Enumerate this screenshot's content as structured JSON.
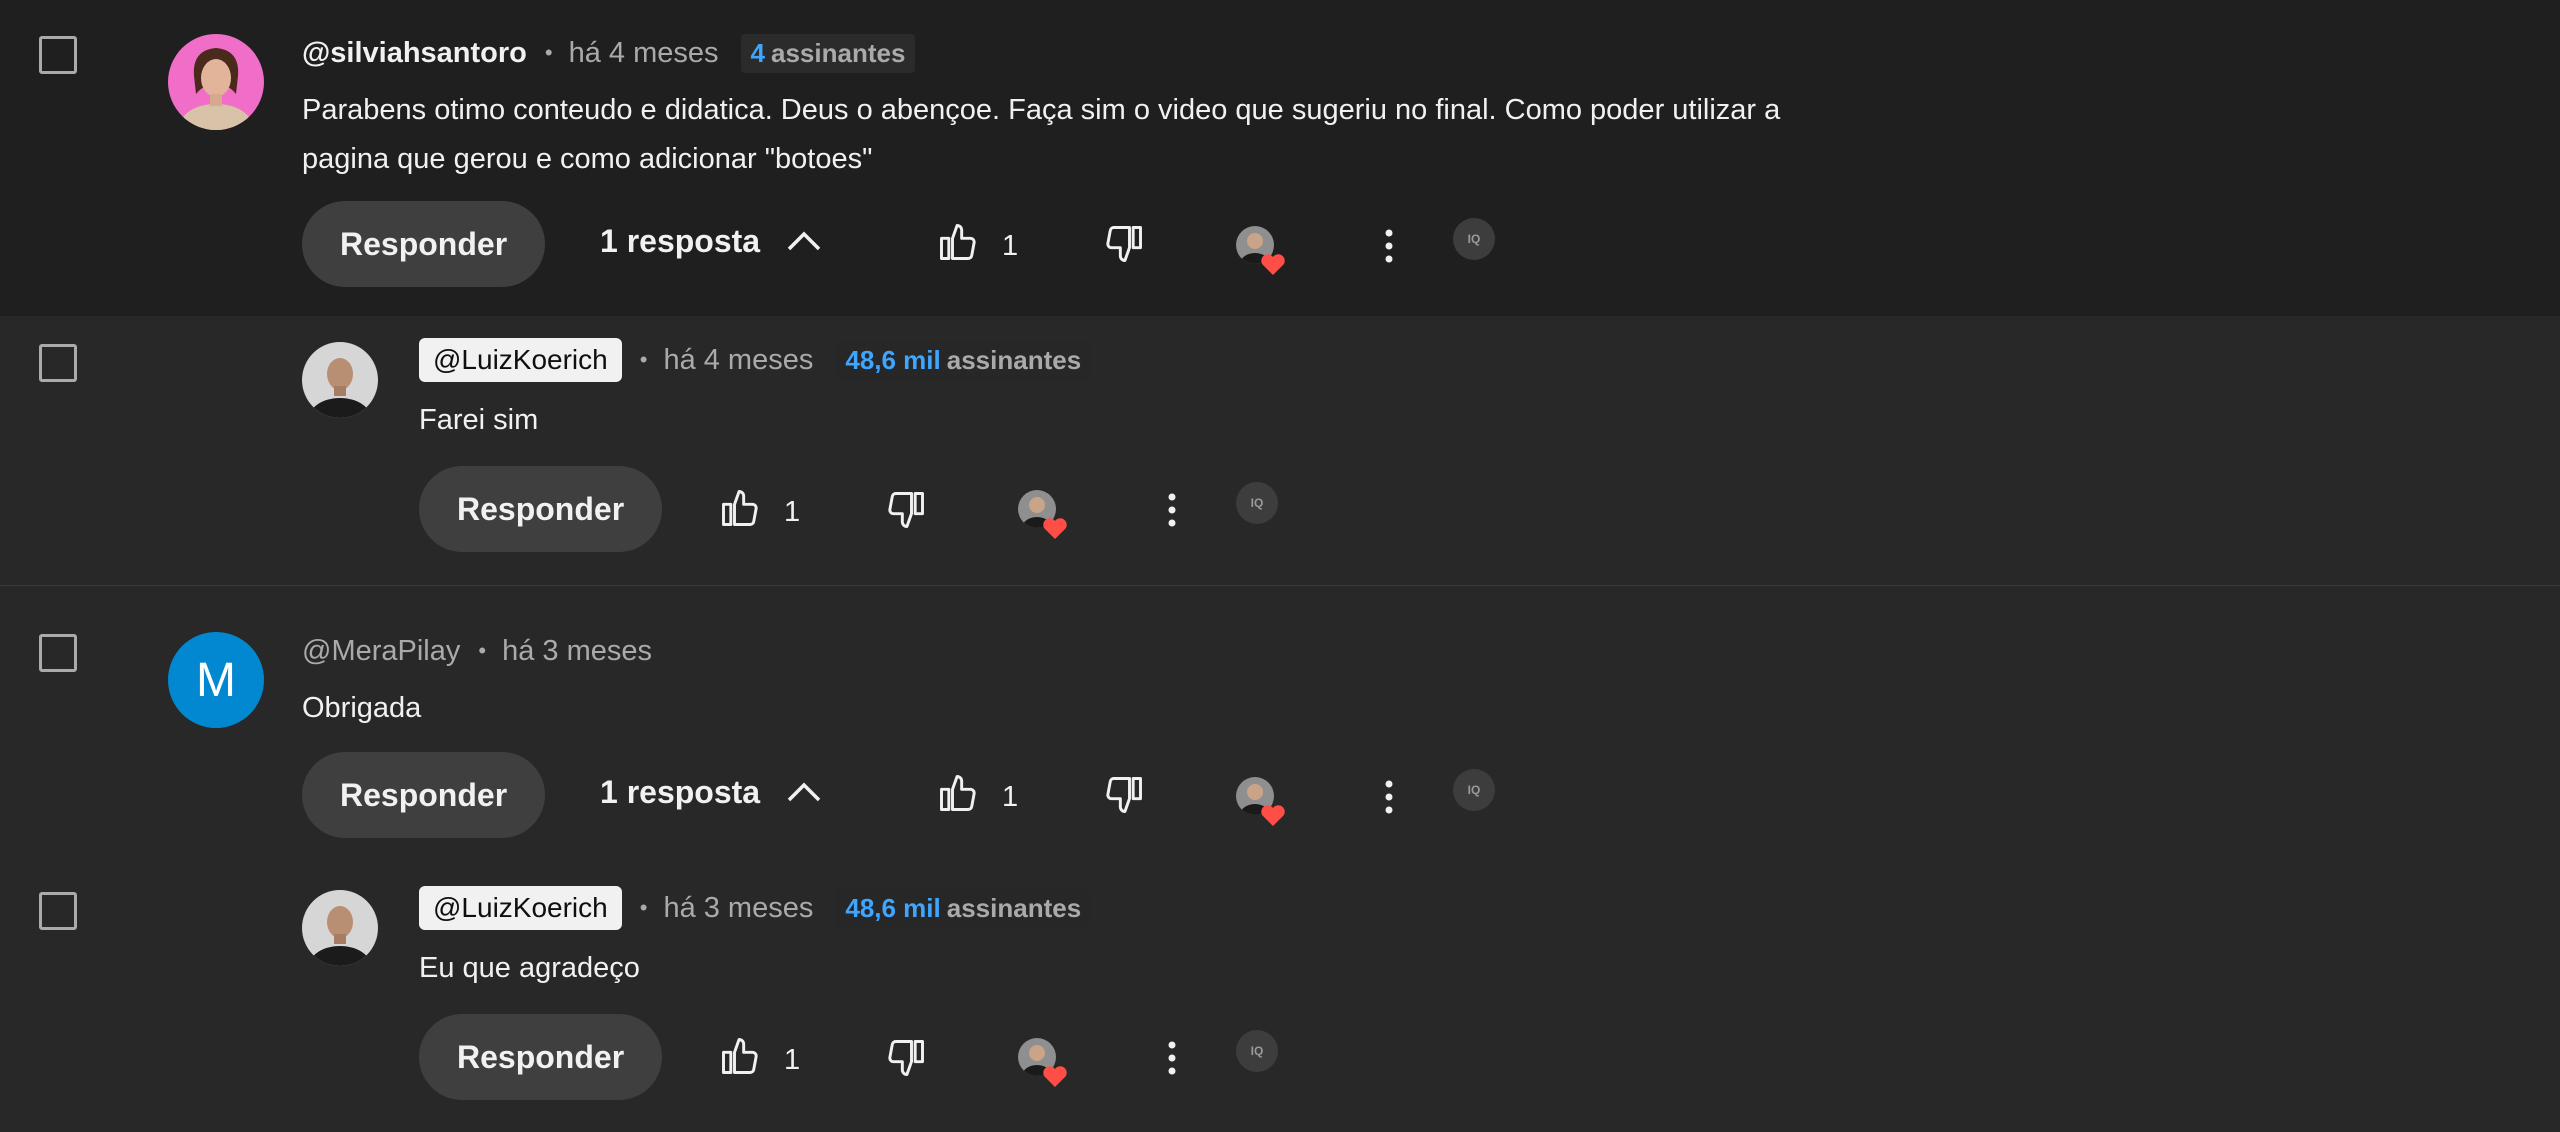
{
  "comments": [
    {
      "author": "@silviahsantoro",
      "time": "há 4 meses",
      "subs_num": "4",
      "subs_label": "assinantes",
      "text_line1": "Parabens otimo conteudo e didatica. Deus o abençoe. Faça sim o video que sugeriu no final. Como poder utilizar a",
      "text_line2": "pagina que gerou e como adicionar \"botoes\"",
      "reply_label": "Responder",
      "replies_label": "1 resposta",
      "likes": "1",
      "reply": {
        "author": "@LuizKoerich",
        "time": "há 4 meses",
        "subs_num": "48,6 mil",
        "subs_label": "assinantes",
        "text": "Farei sim",
        "reply_label": "Responder",
        "likes": "1"
      }
    },
    {
      "author": "@MeraPilay",
      "avatar_letter": "M",
      "time": "há 3 meses",
      "text": "Obrigada",
      "reply_label": "Responder",
      "replies_label": "1 resposta",
      "likes": "1",
      "reply": {
        "author": "@LuizKoerich",
        "time": "há 3 meses",
        "subs_num": "48,6 mil",
        "subs_label": "assinantes",
        "text": "Eu que agradeço",
        "reply_label": "Responder",
        "likes": "1"
      }
    }
  ],
  "icons": {
    "checkbox": "checkbox-icon",
    "like": "thumbs-up-icon",
    "dislike": "thumbs-down-icon",
    "heart": "creator-heart-icon",
    "more": "more-vert-icon",
    "chevron": "chevron-up-icon",
    "extension": "iq-extension-icon"
  },
  "colors": {
    "background": "#282828",
    "highlight_background": "#1f1f1f",
    "text": "#f1f1f1",
    "muted": "#aaaaaa",
    "link_blue": "#3ea6ff",
    "heart_red": "#ff4e45",
    "avatar_blue": "#0288d1"
  }
}
